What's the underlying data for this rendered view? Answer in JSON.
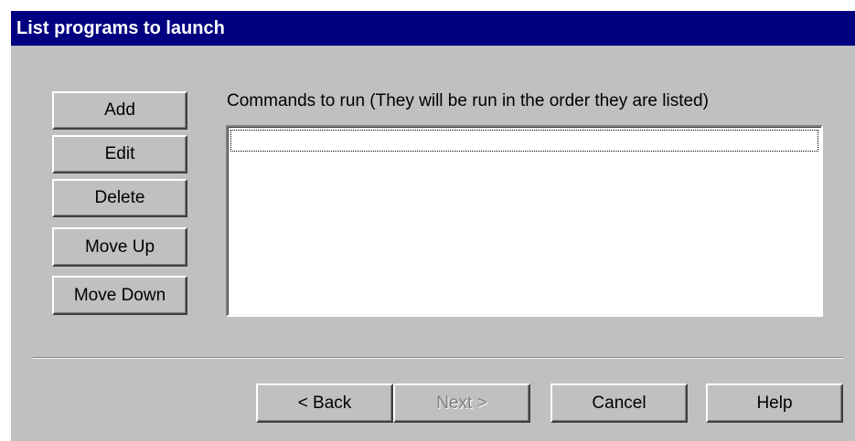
{
  "window": {
    "title": "List programs to launch"
  },
  "side_buttons": {
    "add": "Add",
    "edit": "Edit",
    "delete": "Delete",
    "move_up": "Move Up",
    "move_down": "Move Down"
  },
  "commands": {
    "label": "Commands to run (They will be run in the order they are listed)",
    "items": []
  },
  "footer": {
    "back": "< Back",
    "next": "Next >",
    "cancel": "Cancel",
    "help": "Help"
  }
}
